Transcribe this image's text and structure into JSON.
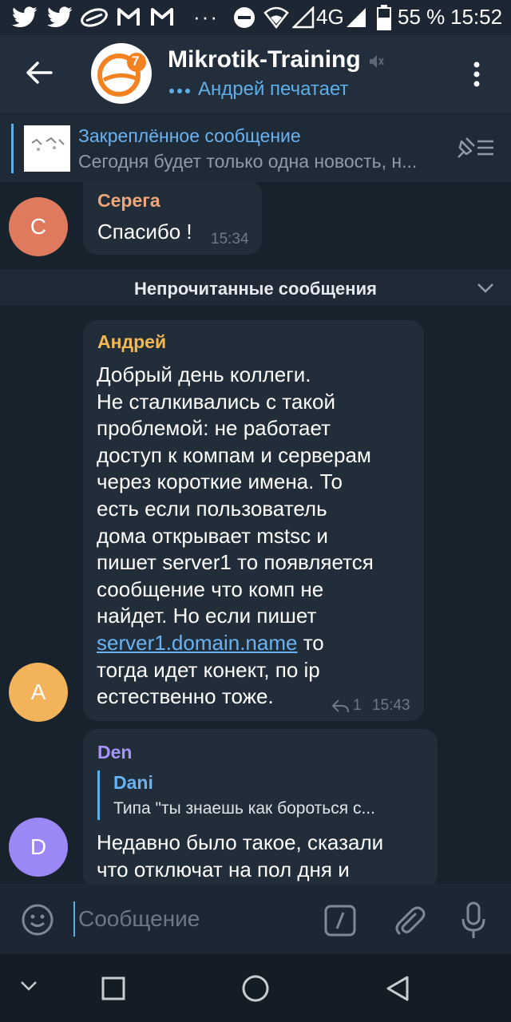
{
  "status_bar": {
    "notification_icons": [
      "twitter-icon",
      "twitter-icon",
      "tidal-icon",
      "gmail-icon",
      "gmail-icon"
    ],
    "more": "···",
    "network": "4G",
    "battery_percent": "55 %",
    "time": "15:52"
  },
  "header": {
    "title": "Mikrotik-Training",
    "subtitle": "Андрей печатает",
    "avatar_badge": "7"
  },
  "pinned": {
    "title": "Закреплённое сообщение",
    "text": "Сегодня будет только одна новость, н..."
  },
  "messages": [
    {
      "sender": "Серега",
      "avatar_letter": "С",
      "avatar_color": "#e07a5f",
      "sender_color": "#f0a678",
      "text": "Спасибо !",
      "time": "15:34"
    },
    {
      "sender": "Андрей",
      "avatar_letter": "А",
      "avatar_color": "#f2b35b",
      "sender_color": "#f5b850",
      "text_before_link": "Добрый день коллеги.\nНе сталкивались с такой\nпроблемой: не работает\nдоступ к компам и серверам\nчерез короткие имена. То\nесть если пользователь\nдома открывает mstsc и\nпишет server1 то появляется\nсообщение что комп не\nнайдет. Но если пишет\n",
      "link": "server1.domain.name",
      "text_after_link": " то\nтогда идет конект, по ip\nестественно тоже.",
      "replies": "1",
      "time": "15:43"
    },
    {
      "sender": "Den",
      "avatar_letter": "D",
      "avatar_color": "#9b87f5",
      "sender_color": "#a595f7",
      "reply_to_name": "Dani",
      "reply_to_text": "Типа \"ты знаешь как бороться с...",
      "text": "Недавно было такое, сказали\nчто отключат на пол дня и"
    }
  ],
  "unread_divider": "Непрочитанные сообщения",
  "composer": {
    "placeholder": "Сообщение"
  },
  "colors": {
    "background": "#18222d",
    "header": "#232e3c",
    "accent": "#5eaee7",
    "bubble": "#222d3a"
  }
}
